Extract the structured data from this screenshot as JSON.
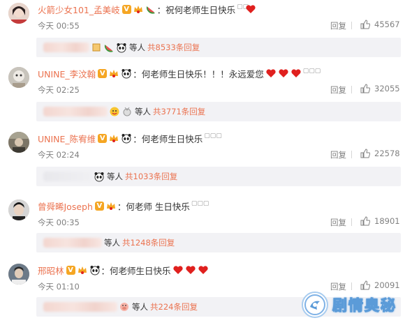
{
  "comments": [
    {
      "username": "火箭少女101_孟美岐",
      "text": "：祝何老师生日快乐",
      "time": "今天 00:55",
      "reply_label": "回复",
      "likes": "45567",
      "reply_suffix": "等人",
      "reply_count": "共8533条回复"
    },
    {
      "username": "UNINE_李汶翰",
      "text": "：何老师生日快乐！！！永远爱您",
      "time": "今天 02:25",
      "reply_label": "回复",
      "likes": "32055",
      "reply_suffix": "等人",
      "reply_count": "共3771条回复"
    },
    {
      "username": "UNINE_陈宥维",
      "text": "：何老师生日快乐",
      "time": "今天 02:24",
      "reply_label": "回复",
      "likes": "22578",
      "reply_suffix": "等人",
      "reply_count": "共1033条回复"
    },
    {
      "username": "曾舜晞Joseph",
      "text": "：何老师 生日快乐",
      "time": "今天 00:35",
      "reply_label": "回复",
      "likes": "18901",
      "reply_suffix": "等人",
      "reply_count": "共1248条回复"
    },
    {
      "username": "邢昭林",
      "text": "：何老师生日快乐",
      "time": "今天 01:10",
      "reply_label": "回复",
      "likes": "20091",
      "reply_suffix": "等人",
      "reply_count": "共224条回复"
    }
  ],
  "watermark": {
    "text": "剧情奥秘"
  },
  "colors": {
    "username": "#eb7350",
    "meta": "#808080",
    "reply_bg": "#f2f2f5",
    "heart": "#e0201e"
  }
}
